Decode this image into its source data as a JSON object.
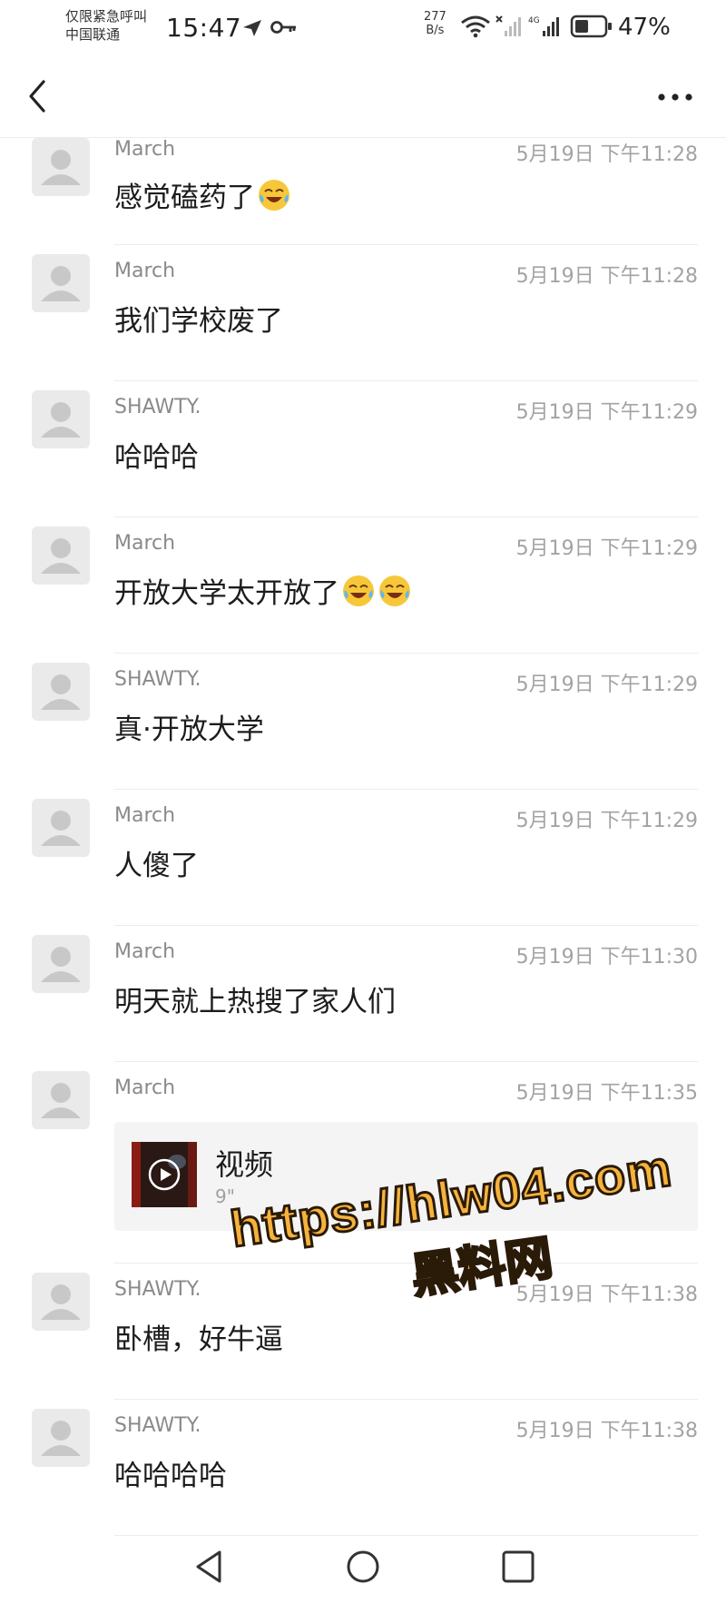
{
  "status_bar": {
    "carrier_line1": "仅限紧急呼叫",
    "carrier_line2": "中国联通",
    "time": "15:47",
    "net_speed_value": "277",
    "net_speed_unit": "B/s",
    "network_type": "4G",
    "battery": "47%"
  },
  "nav": {
    "back_icon": "chevron-left-icon",
    "more_icon": "more-horizontal-icon"
  },
  "messages": [
    {
      "sender": "March",
      "time": "5月19日 下午11:28",
      "text": "感觉磕药了",
      "emoji_count": 1
    },
    {
      "sender": "March",
      "time": "5月19日 下午11:28",
      "text": "我们学校废了",
      "emoji_count": 0
    },
    {
      "sender": "SHAWTY.",
      "time": "5月19日 下午11:29",
      "text": "哈哈哈",
      "emoji_count": 0
    },
    {
      "sender": "March",
      "time": "5月19日 下午11:29",
      "text": "开放大学太开放了",
      "emoji_count": 2
    },
    {
      "sender": "SHAWTY.",
      "time": "5月19日 下午11:29",
      "text": "真·开放大学",
      "emoji_count": 0
    },
    {
      "sender": "March",
      "time": "5月19日 下午11:29",
      "text": "人傻了",
      "emoji_count": 0
    },
    {
      "sender": "March",
      "time": "5月19日 下午11:30",
      "text": "明天就上热搜了家人们",
      "emoji_count": 0
    },
    {
      "sender": "March",
      "time": "5月19日 下午11:35",
      "video_title": "视频",
      "video_duration": "9\""
    },
    {
      "sender": "SHAWTY.",
      "time": "5月19日 下午11:38",
      "text": "卧槽，好牛逼",
      "emoji_count": 0
    },
    {
      "sender": "SHAWTY.",
      "time": "5月19日 下午11:38",
      "text": "哈哈哈哈",
      "emoji_count": 0
    }
  ],
  "watermark": {
    "url": "https://hlw04.com",
    "name": "黑料网"
  },
  "bottom_nav": {
    "back": "triangle-back-icon",
    "home": "circle-home-icon",
    "recent": "square-recent-icon"
  },
  "colors": {
    "sender": "#8a8a8a",
    "time": "#a3a3a3",
    "divider": "#ececec",
    "watermark_fill": "#f6b33c"
  }
}
